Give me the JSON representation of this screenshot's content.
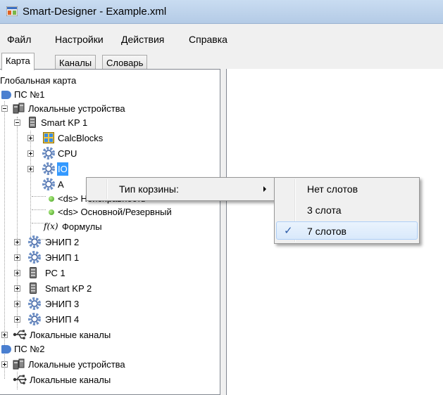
{
  "window": {
    "title": "Smart-Designer - Example.xml"
  },
  "menu": {
    "items": [
      "Файл",
      "Настройки",
      "Действия",
      "Справка"
    ]
  },
  "tabs": [
    {
      "label": "Карта",
      "active": true
    },
    {
      "label": "Каналы",
      "active": false
    },
    {
      "label": "Словарь",
      "active": false
    }
  ],
  "tree": {
    "root": "Глобальная карта",
    "nodes": [
      {
        "label": "ПС №1",
        "icon": "substation-icon"
      },
      {
        "label": "Локальные устройства",
        "icon": "devices-icon"
      },
      {
        "label": "Smart KP 1",
        "icon": "database-icon"
      },
      {
        "label": "CalcBlocks",
        "icon": "calc-blocks-icon"
      },
      {
        "label": "CPU",
        "icon": "gear-icon"
      },
      {
        "label": "IO",
        "icon": "gear-icon",
        "selected": true
      },
      {
        "label": "A",
        "icon": "gear-icon"
      },
      {
        "label": "<ds> Неисправность",
        "icon": "status-dot-icon"
      },
      {
        "label": "<ds> Основной/Резервный",
        "icon": "status-dot-icon"
      },
      {
        "label": "Формулы",
        "icon": "formula-icon",
        "prefix": "f(x)"
      },
      {
        "label": "ЭНИП 2",
        "icon": "gear-icon"
      },
      {
        "label": "ЭНИП 1",
        "icon": "gear-icon"
      },
      {
        "label": "РС 1",
        "icon": "database-icon"
      },
      {
        "label": "Smart KP 2",
        "icon": "database-icon"
      },
      {
        "label": "ЭНИП 3",
        "icon": "gear-icon"
      },
      {
        "label": "ЭНИП 4",
        "icon": "gear-icon"
      },
      {
        "label": "Локальные каналы",
        "icon": "usb-channels-icon"
      },
      {
        "label": "ПС №2",
        "icon": "substation-icon"
      },
      {
        "label": "Локальные устройства",
        "icon": "devices-icon"
      },
      {
        "label": "Локальные каналы",
        "icon": "usb-channels-icon"
      }
    ]
  },
  "context_menu": {
    "item": "Тип корзины:",
    "submenu": [
      {
        "label": "Нет слотов",
        "checked": false
      },
      {
        "label": "3 слота",
        "checked": false
      },
      {
        "label": "7 слотов",
        "checked": true,
        "highlighted": true
      }
    ],
    "check_glyph": "✓"
  },
  "colors": {
    "selection": "#3399ff",
    "titlebar": "#c9dcf1",
    "highlight_border": "#aecff7"
  }
}
